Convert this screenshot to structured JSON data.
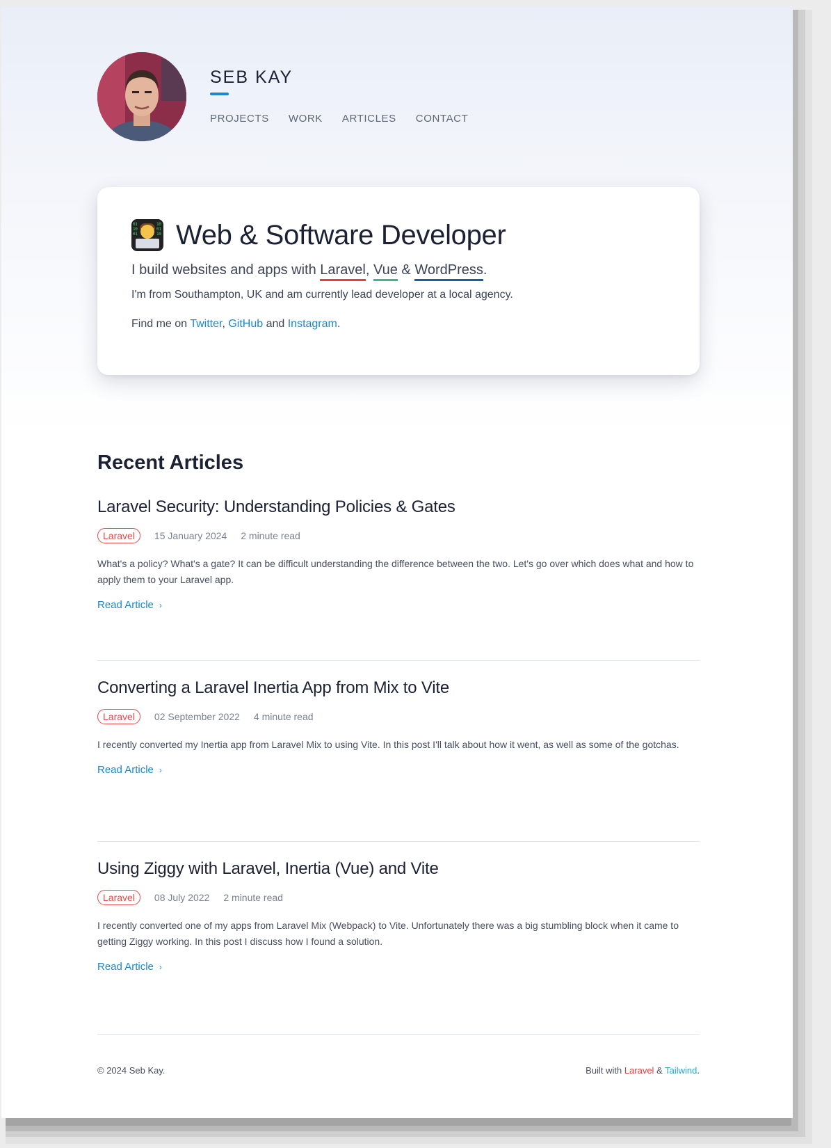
{
  "header": {
    "brand": "SEB KAY",
    "nav": [
      "PROJECTS",
      "WORK",
      "ARTICLES",
      "CONTACT"
    ]
  },
  "hero": {
    "title": "Web & Software Developer",
    "emoji_icon": "technologist-emoji-icon",
    "sub_prefix": "I build websites and apps with ",
    "stack": [
      "Laravel",
      "Vue",
      "WordPress"
    ],
    "sub_sep1": ", ",
    "sub_sep2": " & ",
    "sub_end": ".",
    "about": "I'm from Southampton, UK and am currently lead developer at a local agency.",
    "find_prefix": "Find me on ",
    "socials": [
      "Twitter",
      "GitHub",
      "Instagram"
    ],
    "find_sep1": ", ",
    "find_sep2": " and ",
    "find_end": "."
  },
  "articles": {
    "heading": "Recent Articles",
    "read_label": "Read Article",
    "items": [
      {
        "title": "Laravel Security: Understanding Policies & Gates",
        "tag": "Laravel",
        "date": "15 January 2024",
        "read_time": "2 minute read",
        "excerpt": "What's a policy? What's a gate? It can be difficult understanding the difference between the two. Let's go over which does what and how to apply them to your Laravel app."
      },
      {
        "title": "Converting a Laravel Inertia App from Mix to Vite",
        "tag": "Laravel",
        "date": "02 September 2022",
        "read_time": "4 minute read",
        "excerpt": "I recently converted my Inertia app from Laravel Mix to using Vite. In this post I'll talk about how it went, as well as some of the gotchas."
      },
      {
        "title": "Using Ziggy with Laravel, Inertia (Vue) and Vite",
        "tag": "Laravel",
        "date": "08 July 2022",
        "read_time": "2 minute read",
        "excerpt": "I recently converted one of my apps from Laravel Mix (Webpack) to Vite. Unfortunately there was a big stumbling block when it came to getting Ziggy working. In this post I discuss how I found a solution."
      }
    ]
  },
  "footer": {
    "copyright": "© 2024 Seb Kay.",
    "built_prefix": "Built with ",
    "built_a": "Laravel",
    "built_sep": " & ",
    "built_b": "Tailwind",
    "built_end": "."
  },
  "colors": {
    "accent": "#1d88c9",
    "laravel": "#e53e3e",
    "vue": "#3db68a",
    "wordpress": "#1f5f99"
  }
}
